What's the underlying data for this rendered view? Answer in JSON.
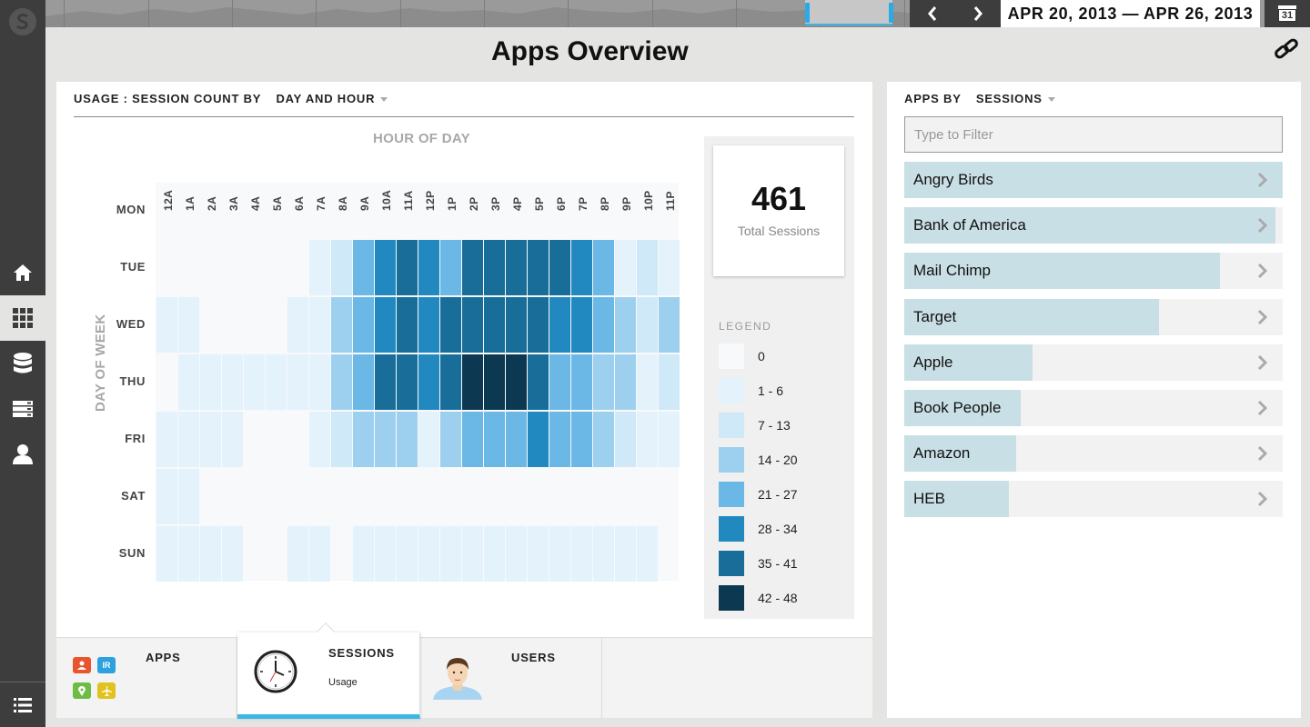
{
  "topbar": {
    "date_range": "APR 20, 2013 — APR 26, 2013",
    "prev_label": "‹",
    "next_label": "›",
    "calendar_day": "31"
  },
  "sidebar": {
    "items": [
      {
        "name": "home-icon",
        "active": false
      },
      {
        "name": "apps-grid-icon",
        "active": true
      },
      {
        "name": "database-icon",
        "active": false
      },
      {
        "name": "server-icon",
        "active": false
      },
      {
        "name": "user-icon",
        "active": false
      }
    ],
    "bottom_icon": "list-icon"
  },
  "page": {
    "title": "Apps Overview"
  },
  "usage_panel": {
    "heading_prefix": "USAGE : SESSION COUNT BY",
    "heading_select": "DAY AND HOUR",
    "x_axis_title": "HOUR OF DAY",
    "y_axis_title": "DAY OF WEEK"
  },
  "chart_data": {
    "type": "heatmap",
    "title": "USAGE : SESSION COUNT BY DAY AND HOUR",
    "xlabel": "HOUR OF DAY",
    "ylabel": "DAY OF WEEK",
    "x": [
      "12A",
      "1A",
      "2A",
      "3A",
      "4A",
      "5A",
      "6A",
      "7A",
      "8A",
      "9A",
      "10A",
      "11A",
      "12P",
      "1P",
      "2P",
      "3P",
      "4P",
      "5P",
      "6P",
      "7P",
      "8P",
      "9P",
      "10P",
      "11P"
    ],
    "y": [
      "MON",
      "TUE",
      "WED",
      "THU",
      "FRI",
      "SAT",
      "SUN"
    ],
    "bins": [
      "0",
      "1 - 6",
      "7 - 13",
      "14 - 20",
      "21 - 27",
      "28 - 34",
      "35 - 41",
      "42 - 48"
    ],
    "colors": [
      "#f7f9fa",
      "#e4f2fb",
      "#cfe9f8",
      "#9dd0ef",
      "#6bb8e6",
      "#2189bf",
      "#186e99",
      "#0c3852"
    ],
    "levels": [
      [
        0,
        0,
        0,
        0,
        0,
        0,
        0,
        0,
        0,
        0,
        0,
        0,
        0,
        0,
        0,
        0,
        0,
        0,
        0,
        0,
        0,
        0,
        0,
        0
      ],
      [
        0,
        0,
        0,
        0,
        0,
        0,
        0,
        1,
        2,
        4,
        5,
        6,
        5,
        4,
        6,
        6,
        6,
        6,
        6,
        5,
        4,
        1,
        2,
        1
      ],
      [
        1,
        1,
        0,
        0,
        0,
        0,
        1,
        1,
        3,
        4,
        5,
        6,
        5,
        6,
        6,
        6,
        6,
        6,
        5,
        5,
        4,
        3,
        2,
        3
      ],
      [
        0,
        1,
        1,
        1,
        1,
        1,
        1,
        1,
        3,
        4,
        6,
        6,
        5,
        6,
        7,
        7,
        7,
        6,
        4,
        4,
        3,
        3,
        1,
        2
      ],
      [
        1,
        1,
        1,
        1,
        0,
        0,
        0,
        1,
        2,
        3,
        3,
        3,
        1,
        3,
        4,
        4,
        4,
        5,
        4,
        4,
        3,
        2,
        1,
        1
      ],
      [
        1,
        1,
        0,
        0,
        0,
        0,
        0,
        0,
        0,
        0,
        0,
        0,
        0,
        0,
        0,
        0,
        0,
        0,
        0,
        0,
        0,
        0,
        0,
        0
      ],
      [
        1,
        1,
        1,
        1,
        0,
        0,
        1,
        1,
        0,
        1,
        1,
        1,
        1,
        1,
        1,
        1,
        1,
        1,
        1,
        1,
        1,
        1,
        1,
        0
      ]
    ],
    "total_sessions": 461,
    "total_label": "Total Sessions",
    "legend_title": "LEGEND"
  },
  "tabs": [
    {
      "title": "APPS",
      "sub": "",
      "active": false
    },
    {
      "title": "SESSIONS",
      "sub": "Usage",
      "active": true
    },
    {
      "title": "USERS",
      "sub": "",
      "active": false
    }
  ],
  "apps_panel": {
    "heading_prefix": "APPS BY",
    "heading_select": "SESSIONS",
    "filter_placeholder": "Type to Filter",
    "apps": [
      {
        "name": "Angry Birds",
        "share": 1.0
      },
      {
        "name": "Bank of America",
        "share": 0.98
      },
      {
        "name": "Mail Chimp",
        "share": 0.835
      },
      {
        "name": "Target",
        "share": 0.672
      },
      {
        "name": "Apple",
        "share": 0.338
      },
      {
        "name": "Book People",
        "share": 0.307
      },
      {
        "name": "Amazon",
        "share": 0.295
      },
      {
        "name": "HEB",
        "share": 0.276
      }
    ]
  },
  "colors": {
    "sidebar": "#3d3d3d",
    "accent": "#3cb6e6",
    "app_bar": "#c9dfe6"
  }
}
